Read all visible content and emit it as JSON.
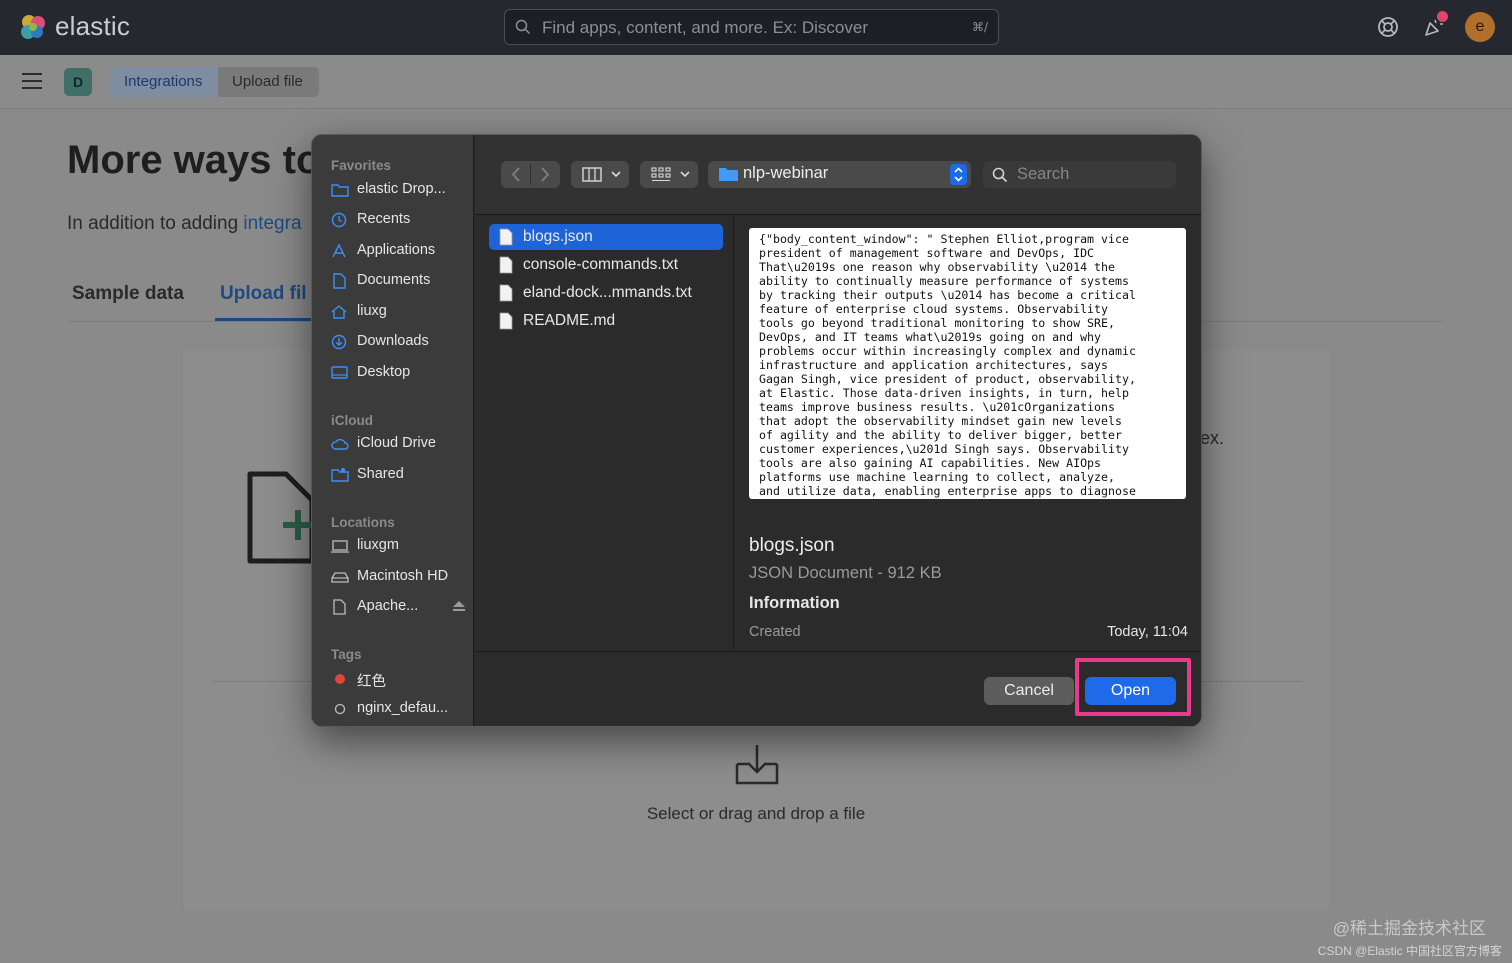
{
  "app": {
    "brand": "elastic",
    "search_placeholder": "Find apps, content, and more. Ex: Discover",
    "search_shortcut": "⌘/",
    "user_initial": "e",
    "space_initial": "D"
  },
  "breadcrumbs": [
    "Integrations",
    "Upload file"
  ],
  "page": {
    "title_visible": "More ways to",
    "subtitle_prefix": "In addition to adding ",
    "subtitle_link": "integra",
    "tabs": [
      "Sample data",
      "Upload fil"
    ],
    "side_fragment": "ex.",
    "drop_text": "Select or drag and drop a file"
  },
  "dialog": {
    "sidebar": {
      "favorites_header": "Favorites",
      "favorites": [
        "elastic Drop...",
        "Recents",
        "Applications",
        "Documents",
        "liuxg",
        "Downloads",
        "Desktop"
      ],
      "icloud_header": "iCloud",
      "icloud": [
        "iCloud Drive",
        "Shared"
      ],
      "locations_header": "Locations",
      "locations": [
        "liuxgm",
        "Macintosh HD",
        "Apache..."
      ],
      "tags_header": "Tags",
      "tags": [
        "红色",
        "nginx_defau..."
      ],
      "tag_colors": [
        "#e0453c",
        "transparent"
      ]
    },
    "toolbar": {
      "current_folder": "nlp-webinar",
      "search_placeholder": "Search"
    },
    "files": [
      "blogs.json",
      "console-commands.txt",
      "eland-dock...mmands.txt",
      "README.md"
    ],
    "selected_file_index": 0,
    "preview": {
      "content": "{\"body_content_window\": \" Stephen Elliot,program vice\npresident of management software and DevOps, IDC\nThat\\u2019s one reason why observability \\u2014 the\nability to continually measure performance of systems\nby tracking their outputs \\u2014 has become a critical\nfeature of enterprise cloud systems. Observability\ntools go beyond traditional monitoring to show SRE,\nDevOps, and IT teams what\\u2019s going on and why\nproblems occur within increasingly complex and dynamic\ninfrastructure and application architectures, says\nGagan Singh, vice president of product, observability,\nat Elastic. Those data-driven insights, in turn, help\nteams improve business results. \\u201cOrganizations\nthat adopt the observability mindset gain new levels\nof agility and the ability to deliver bigger, better\ncustomer experiences,\\u201d Singh says. Observability\ntools are also gaining AI capabilities. New AIOps\nplatforms use machine learning to collect, analyze,\nand utilize data, enabling enterprise apps to diagnose",
      "file_name": "blogs.json",
      "file_kind": "JSON Document - 912 KB",
      "info_header": "Information",
      "created_label": "Created",
      "created_value": "Today, 11:04"
    },
    "buttons": {
      "cancel": "Cancel",
      "open": "Open"
    }
  },
  "watermark": {
    "line1": "@稀土掘金技术社区",
    "line2": "CSDN @Elastic 中国社区官方博客"
  },
  "colors": {
    "accent_blue": "#1f6ae8",
    "highlight_pink": "#e8398a",
    "header_bg": "#25282f"
  }
}
